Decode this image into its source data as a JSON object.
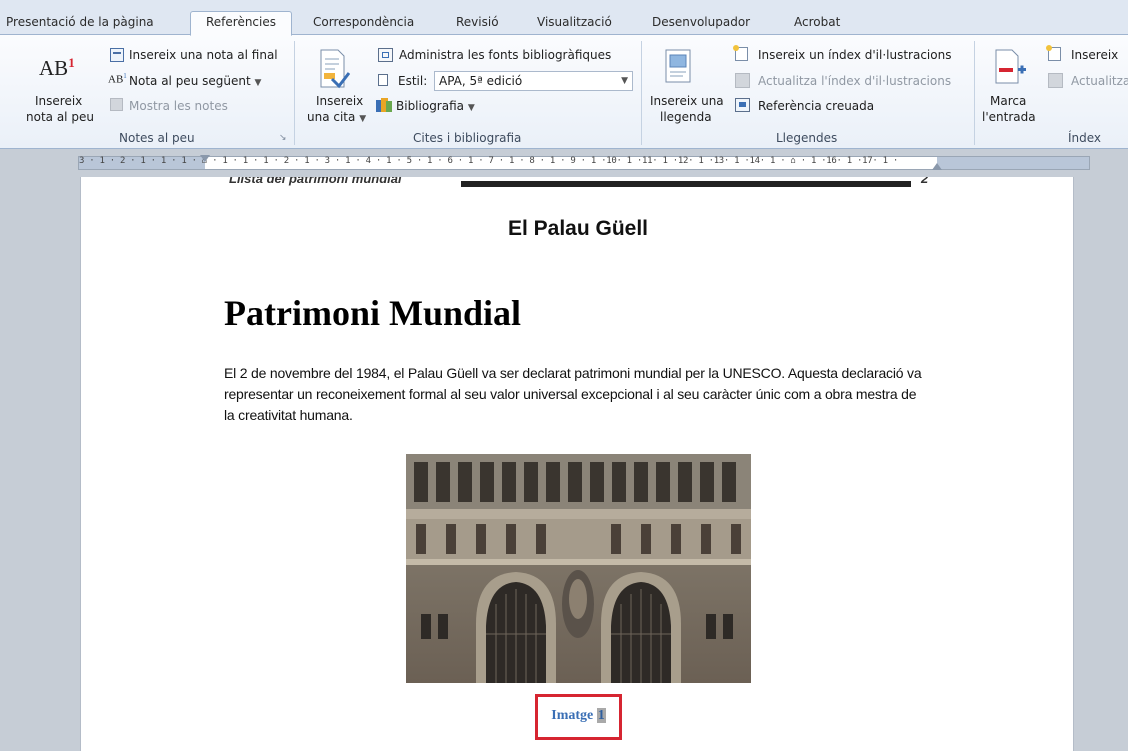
{
  "tabs": [
    "Presentació de la pàgina",
    "Referències",
    "Correspondència",
    "Revisió",
    "Visualització",
    "Desenvolupador",
    "Acrobat"
  ],
  "active_tab": "Referències",
  "ribbon": {
    "footnotes": {
      "insert_footnote_l1": "Insereix",
      "insert_footnote_l2": "nota al peu",
      "insert_endnote": "Insereix una nota al final",
      "next_footnote": "Nota al peu següent",
      "show_notes": "Mostra les notes",
      "group_label": "Notes al peu"
    },
    "citations": {
      "insert_citation_l1": "Insereix",
      "insert_citation_l2": "una cita",
      "manage_sources": "Administra les fonts bibliogràfiques",
      "style_label": "Estil:",
      "style_value": "APA, 5ª edició",
      "bibliography": "Bibliografia",
      "group_label": "Cites i bibliografia"
    },
    "captions": {
      "insert_caption_l1": "Insereix una",
      "insert_caption_l2": "llegenda",
      "insert_table_figures": "Insereix un índex d'il·lustracions",
      "update_table": "Actualitza l'índex d'il·lustracions",
      "cross_reference": "Referència creuada",
      "group_label": "Llegendes"
    },
    "index": {
      "mark_entry_l1": "Marca",
      "mark_entry_l2": "l'entrada",
      "insert_index": "Insereix",
      "update_index": "Actualitza",
      "group_label": "Índex"
    }
  },
  "ruler": "3 · 1 · 2 · 1 · 1 · 1 · ⌂ · 1 · 1 · 1 · 2 · 1 · 3 · 1 · 4 · 1 · 5 · 1 · 6 · 1 · 7 · 1 · 8 · 1 · 9 · 1 ·10· 1 ·11· 1 ·12· 1 ·13· 1 ·14· 1 · ⌂ · 1 ·16· 1 ·17· 1 ·",
  "document": {
    "cut_line_text": "Llista del patrimoni mundial",
    "cut_line_page": "2",
    "header_title": "El Palau Güell",
    "heading": "Patrimoni Mundial",
    "paragraph": "El 2 de novembre del 1984, el Palau Güell va ser declarat patrimoni mundial per la UNESCO. Aquesta declaració va representar un reconeixement formal al seu valor universal excepcional i al seu caràcter únic com a obra mestra de la creativitat humana.",
    "caption_word": "Imatge",
    "caption_number": "1"
  }
}
